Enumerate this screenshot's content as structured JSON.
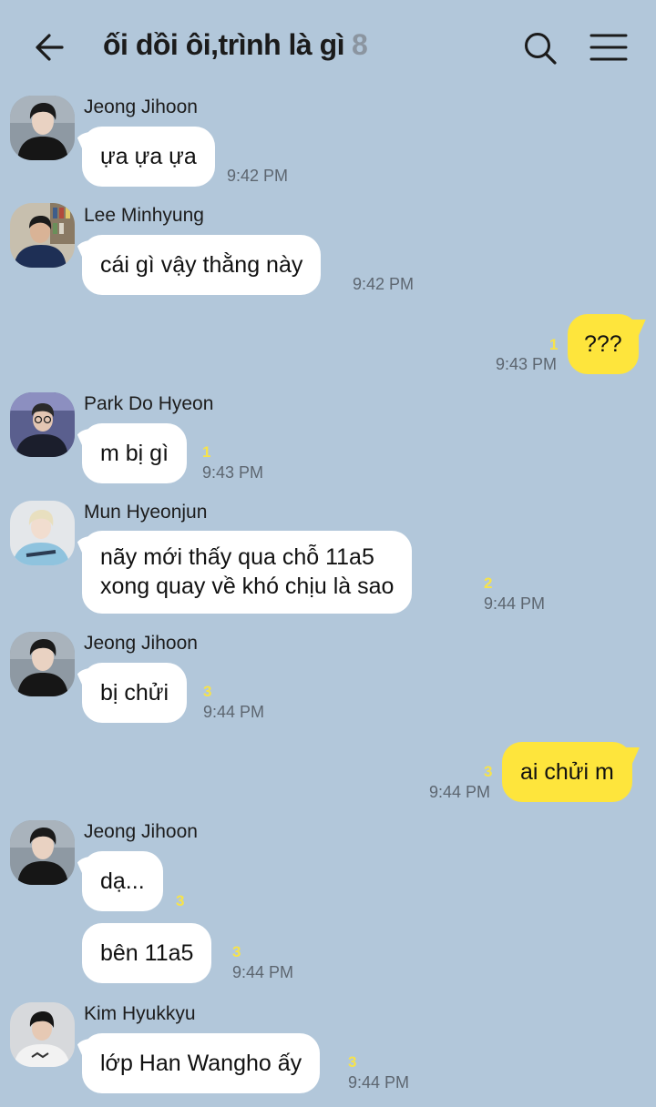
{
  "header": {
    "title": "ối dồi ôi,trình là gì",
    "member_count": "8",
    "back_icon": "arrow-left-icon",
    "search_icon": "search-icon",
    "menu_icon": "hamburger-menu-icon"
  },
  "colors": {
    "background": "#b2c7da",
    "my_bubble": "#fee53c",
    "other_bubble": "#ffffff",
    "unread_count": "#f7e34a"
  },
  "messages": [
    {
      "sender": "Jeong Jihoon",
      "text": "ựa ựa ựa",
      "time": "9:42 PM",
      "unread": ""
    },
    {
      "sender": "Lee Minhyung",
      "text": "cái gì vậy thằng này",
      "time": "9:42 PM",
      "unread": ""
    },
    {
      "sender": "me",
      "text": "???",
      "time": "9:43 PM",
      "unread": "1"
    },
    {
      "sender": "Park Do Hyeon",
      "text": "m bị gì",
      "time": "9:43 PM",
      "unread": "1"
    },
    {
      "sender": "Mun Hyeonjun",
      "lines": [
        "nãy mới thấy qua chỗ 11a5",
        "xong quay về khó chịu là sao"
      ],
      "time": "9:44 PM",
      "unread": "2"
    },
    {
      "sender": "Jeong Jihoon",
      "text": "bị chửi",
      "time": "9:44 PM",
      "unread": "3"
    },
    {
      "sender": "me",
      "text": "ai chửi m",
      "time": "9:44 PM",
      "unread": "3"
    },
    {
      "sender": "Jeong Jihoon",
      "text": "dạ...",
      "time": "",
      "unread": "3"
    },
    {
      "sender": "Jeong Jihoon",
      "text": "bên 11a5",
      "time": "9:44 PM",
      "unread": "3"
    },
    {
      "sender": "Kim Hyukkyu",
      "text": "lớp Han Wangho ấy",
      "time": "9:44 PM",
      "unread": "3"
    }
  ]
}
